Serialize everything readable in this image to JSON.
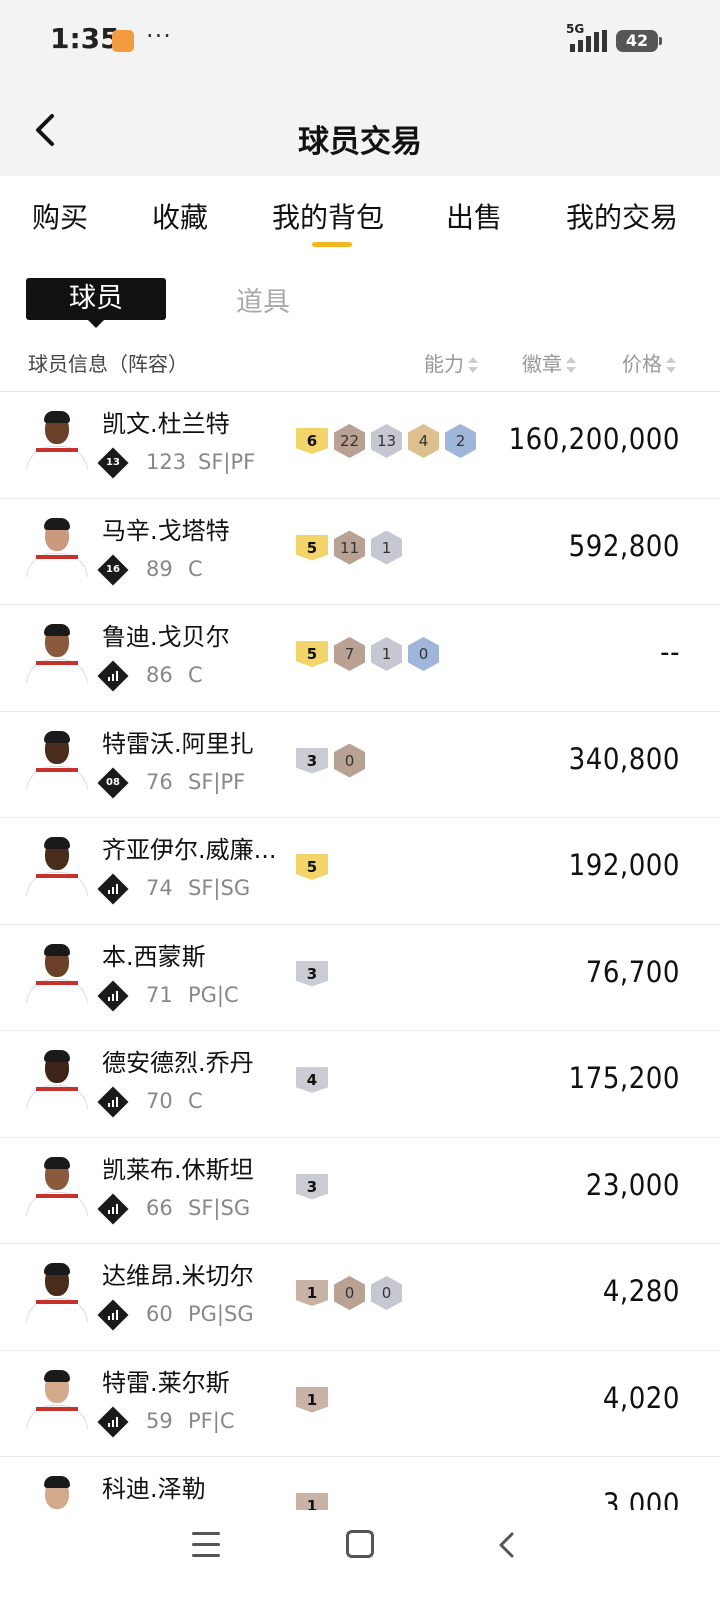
{
  "status_bar": {
    "time": "1:35",
    "dots": "···",
    "network": "5G",
    "battery": "42",
    "app_icon_color": "#f19a3e"
  },
  "header": {
    "title": "球员交易",
    "back_icon": "chevron-left-icon"
  },
  "tabs": [
    {
      "label": "购买"
    },
    {
      "label": "收藏"
    },
    {
      "label": "我的背包",
      "active": true
    },
    {
      "label": "出售"
    },
    {
      "label": "我的交易"
    }
  ],
  "subtabs": {
    "player": "球员",
    "item": "道具"
  },
  "list_header": {
    "info": "球员信息（阵容）",
    "ability": "能力",
    "badges": "徽章",
    "price": "价格"
  },
  "players": [
    {
      "name": "凯文.杜兰特",
      "tier": "13",
      "rating": "123",
      "position": "SF|PF",
      "level": "6",
      "level_color": "gold",
      "badges": [
        {
          "v": "22",
          "c": "bronze"
        },
        {
          "v": "13",
          "c": "silver"
        },
        {
          "v": "4",
          "c": "gold"
        },
        {
          "v": "2",
          "c": "blue"
        }
      ],
      "price": "160,200,000",
      "skin": "#6b4028"
    },
    {
      "name": "马辛.戈塔特",
      "tier": "16",
      "rating": "89",
      "position": "C",
      "level": "5",
      "level_color": "gold",
      "badges": [
        {
          "v": "11",
          "c": "bronze"
        },
        {
          "v": "1",
          "c": "silver"
        }
      ],
      "price": "592,800",
      "skin": "#c99a80"
    },
    {
      "name": "鲁迪.戈贝尔",
      "tier": "",
      "rating": "86",
      "position": "C",
      "level": "5",
      "level_color": "gold",
      "badges": [
        {
          "v": "7",
          "c": "bronze"
        },
        {
          "v": "1",
          "c": "silver"
        },
        {
          "v": "0",
          "c": "blue"
        }
      ],
      "price": "--",
      "skin": "#8b5a3c"
    },
    {
      "name": "特雷沃.阿里扎",
      "tier": "08",
      "rating": "76",
      "position": "SF|PF",
      "level": "3",
      "level_color": "silver",
      "badges": [
        {
          "v": "0",
          "c": "bronze"
        }
      ],
      "price": "340,800",
      "skin": "#4a2c1c"
    },
    {
      "name": "齐亚伊尔.威廉...",
      "tier": "",
      "rating": "74",
      "position": "SF|SG",
      "level": "5",
      "level_color": "gold",
      "badges": [],
      "price": "192,000",
      "skin": "#4a2c1c"
    },
    {
      "name": "本.西蒙斯",
      "tier": "",
      "rating": "71",
      "position": "PG|C",
      "level": "3",
      "level_color": "silver",
      "badges": [],
      "price": "76,700",
      "skin": "#6b4028"
    },
    {
      "name": "德安德烈.乔丹",
      "tier": "",
      "rating": "70",
      "position": "C",
      "level": "4",
      "level_color": "silver",
      "badges": [],
      "price": "175,200",
      "skin": "#3e2418"
    },
    {
      "name": "凯莱布.休斯坦",
      "tier": "",
      "rating": "66",
      "position": "SF|SG",
      "level": "3",
      "level_color": "silver",
      "badges": [],
      "price": "23,000",
      "skin": "#8b5a3c"
    },
    {
      "name": "达维昂.米切尔",
      "tier": "",
      "rating": "60",
      "position": "PG|SG",
      "level": "1",
      "level_color": "bronze",
      "badges": [
        {
          "v": "0",
          "c": "bronze"
        },
        {
          "v": "0",
          "c": "silver"
        }
      ],
      "price": "4,280",
      "skin": "#4a2c1c"
    },
    {
      "name": "特雷.莱尔斯",
      "tier": "",
      "rating": "59",
      "position": "PF|C",
      "level": "1",
      "level_color": "bronze",
      "badges": [],
      "price": "4,020",
      "skin": "#d2a98a"
    },
    {
      "name": "科迪.泽勒",
      "tier": "",
      "rating": "",
      "position": "",
      "level": "1",
      "level_color": "bronze",
      "badges": [],
      "price": "3,000",
      "skin": "#d2a98a"
    }
  ],
  "colors": {
    "accent": "#f2b71f",
    "level_gold": "#f3d46a",
    "level_silver": "#c9ccd3",
    "level_bronze": "#c9b2a6",
    "badge_bronze": "#b9a294",
    "badge_silver": "#c5c8d0",
    "badge_gold": "#dcc08e",
    "badge_blue": "#9fb6da"
  },
  "nav": {
    "menu_icon": "menu-icon",
    "home_icon": "home-icon",
    "back_icon": "back-icon"
  }
}
